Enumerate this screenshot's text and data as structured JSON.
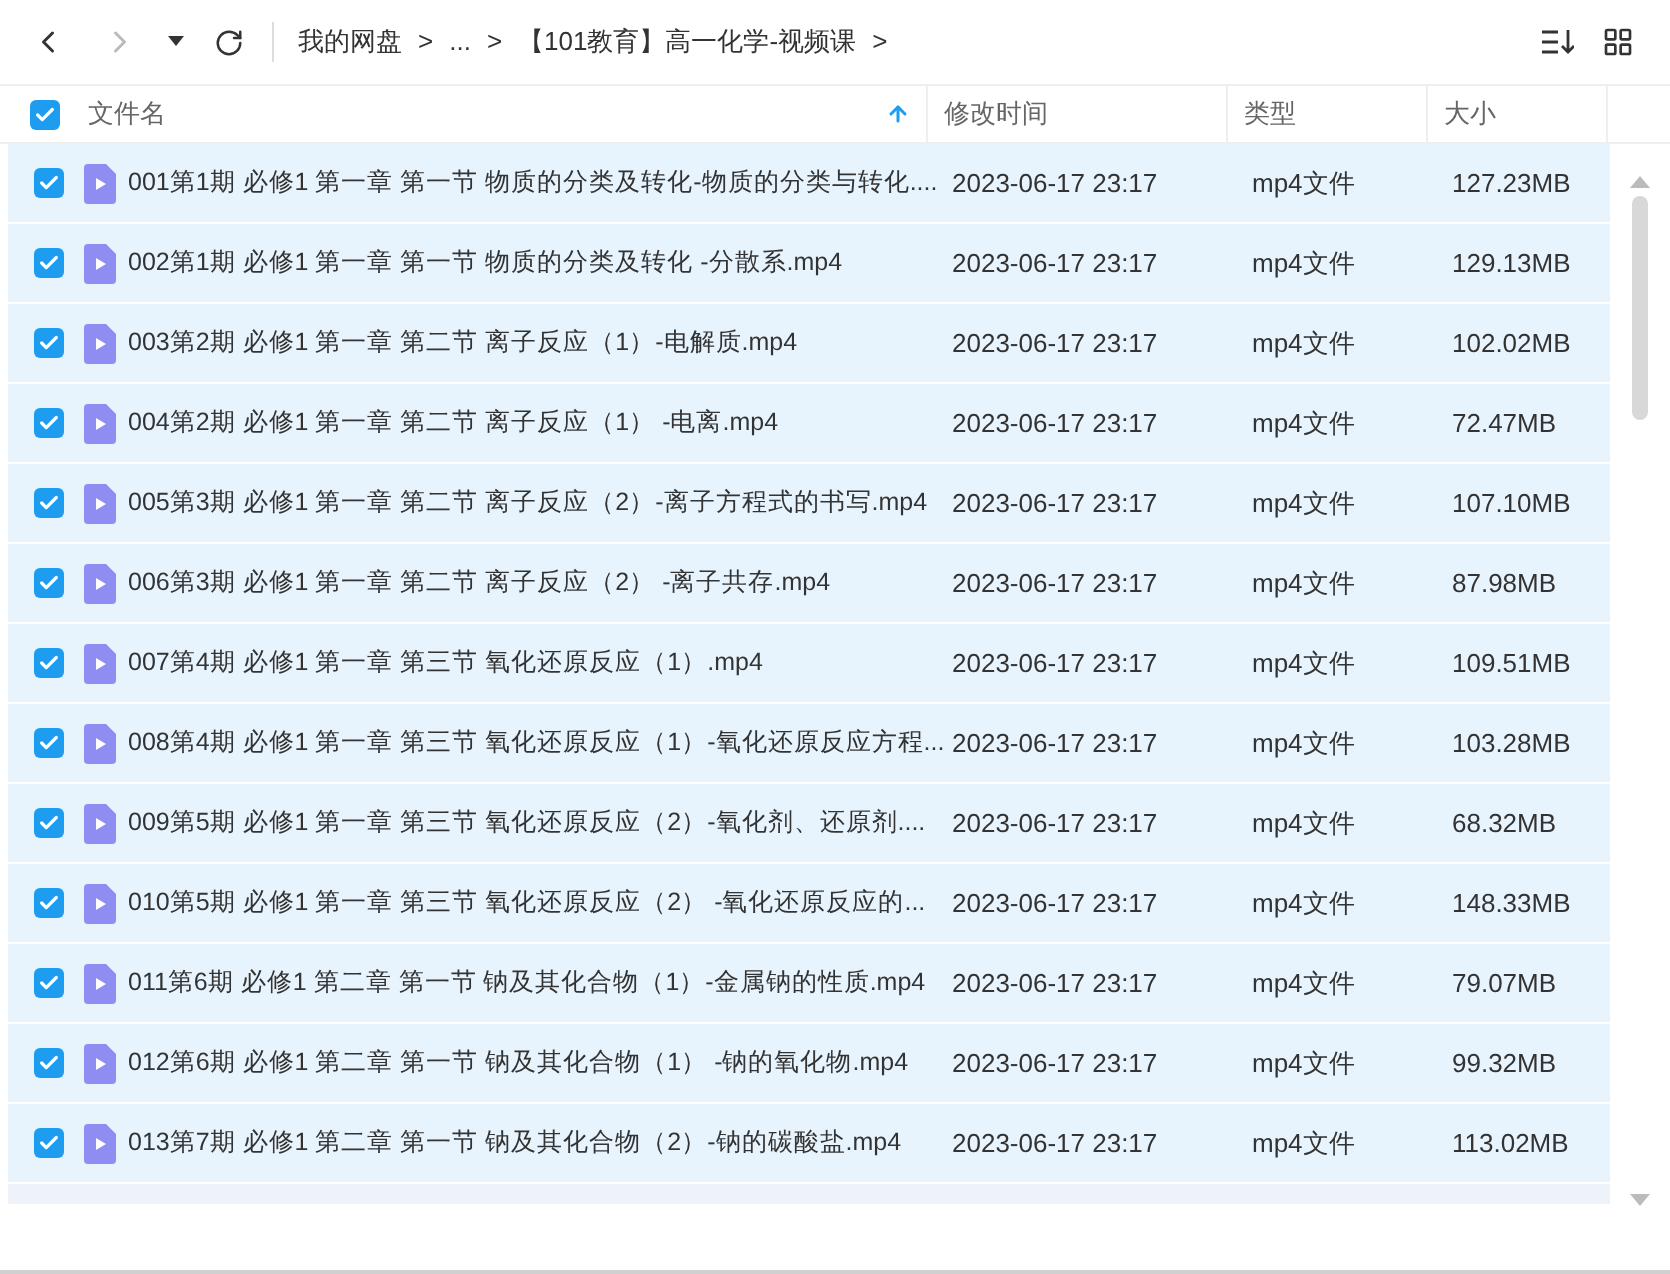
{
  "toolbar": {
    "breadcrumbs": [
      {
        "label": "我的网盘"
      },
      {
        "label": "..."
      },
      {
        "label": "【101教育】高一化学-视频课"
      }
    ],
    "separator": ">"
  },
  "table": {
    "select_all": {
      "checked": true
    },
    "columns": [
      {
        "label": "文件名",
        "sorted": true
      },
      {
        "label": "修改时间",
        "sorted": false
      },
      {
        "label": "类型",
        "sorted": false
      },
      {
        "label": "大小",
        "sorted": false
      }
    ],
    "rows": [
      {
        "name": "001第1期 必修1 第一章 第一节 物质的分类及转化-物质的分类与转化....",
        "modified": "2023-06-17 23:17",
        "type": "mp4文件",
        "size": "127.23MB",
        "selected": true
      },
      {
        "name": "002第1期 必修1 第一章 第一节 物质的分类及转化 -分散系.mp4",
        "modified": "2023-06-17 23:17",
        "type": "mp4文件",
        "size": "129.13MB",
        "selected": true
      },
      {
        "name": "003第2期 必修1 第一章 第二节 离子反应（1）-电解质.mp4",
        "modified": "2023-06-17 23:17",
        "type": "mp4文件",
        "size": "102.02MB",
        "selected": true
      },
      {
        "name": "004第2期 必修1 第一章 第二节 离子反应（1） -电离.mp4",
        "modified": "2023-06-17 23:17",
        "type": "mp4文件",
        "size": "72.47MB",
        "selected": true
      },
      {
        "name": "005第3期 必修1 第一章 第二节 离子反应（2）-离子方程式的书写.mp4",
        "modified": "2023-06-17 23:17",
        "type": "mp4文件",
        "size": "107.10MB",
        "selected": true
      },
      {
        "name": "006第3期 必修1 第一章 第二节 离子反应（2） -离子共存.mp4",
        "modified": "2023-06-17 23:17",
        "type": "mp4文件",
        "size": "87.98MB",
        "selected": true
      },
      {
        "name": "007第4期 必修1 第一章 第三节 氧化还原反应（1）.mp4",
        "modified": "2023-06-17 23:17",
        "type": "mp4文件",
        "size": "109.51MB",
        "selected": true
      },
      {
        "name": "008第4期 必修1 第一章 第三节 氧化还原反应（1）-氧化还原反应方程...",
        "modified": "2023-06-17 23:17",
        "type": "mp4文件",
        "size": "103.28MB",
        "selected": true
      },
      {
        "name": "009第5期 必修1 第一章 第三节 氧化还原反应（2）-氧化剂、还原剂....",
        "modified": "2023-06-17 23:17",
        "type": "mp4文件",
        "size": "68.32MB",
        "selected": true
      },
      {
        "name": "010第5期 必修1 第一章 第三节 氧化还原反应（2） -氧化还原反应的...",
        "modified": "2023-06-17 23:17",
        "type": "mp4文件",
        "size": "148.33MB",
        "selected": true
      },
      {
        "name": "011第6期 必修1 第二章 第一节 钠及其化合物（1）-金属钠的性质.mp4",
        "modified": "2023-06-17 23:17",
        "type": "mp4文件",
        "size": "79.07MB",
        "selected": true
      },
      {
        "name": "012第6期 必修1 第二章 第一节 钠及其化合物（1） -钠的氧化物.mp4",
        "modified": "2023-06-17 23:17",
        "type": "mp4文件",
        "size": "99.32MB",
        "selected": true
      },
      {
        "name": "013第7期 必修1 第二章 第一节 钠及其化合物（2）-钠的碳酸盐.mp4",
        "modified": "2023-06-17 23:17",
        "type": "mp4文件",
        "size": "113.02MB",
        "selected": true
      }
    ]
  }
}
